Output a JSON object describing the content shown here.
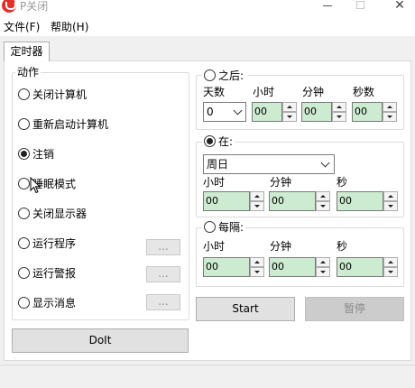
{
  "window": {
    "title": "P关闭"
  },
  "menu": {
    "file": "文件(F)",
    "help": "帮助(H)"
  },
  "tab": {
    "label": "定时器"
  },
  "action": {
    "label": "动作",
    "options": [
      "关闭计算机",
      "重新启动计算机",
      "注销",
      "睡眠模式",
      "关闭显示器",
      "运行程序",
      "运行警报",
      "显示消息"
    ],
    "selected": "注销",
    "browse_label": "...",
    "doit_label": "DoIt"
  },
  "after": {
    "label": "之后:",
    "checked": false,
    "days_label": "天数",
    "hours_label": "小时",
    "minutes_label": "分钟",
    "seconds_label": "秒数",
    "days_value": "0",
    "hours_value": "00",
    "minutes_value": "00",
    "seconds_value": "00"
  },
  "at": {
    "label": "在:",
    "checked": true,
    "day_value": "周日",
    "hours_label": "小时",
    "minutes_label": "分钟",
    "seconds_label": "秒",
    "hours_value": "00",
    "minutes_value": "00",
    "seconds_value": "00"
  },
  "every": {
    "label": "每隔:",
    "checked": false,
    "hours_label": "小时",
    "minutes_label": "分钟",
    "seconds_label": "秒",
    "hours_value": "00",
    "minutes_value": "00",
    "seconds_value": "00"
  },
  "controls": {
    "start_label": "Start",
    "pause_label": "暂停"
  },
  "colors": {
    "input_bg": "#cdebd0",
    "icon_red": "#e0312b"
  }
}
